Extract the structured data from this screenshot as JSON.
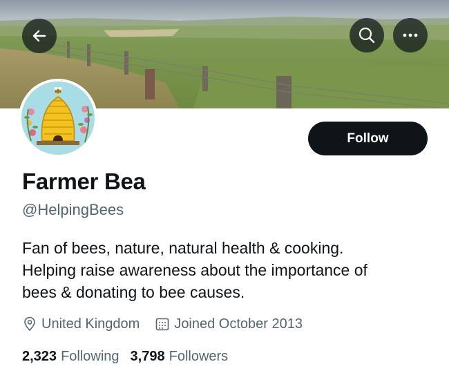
{
  "header": {
    "back_icon": "arrow-left-icon",
    "search_icon": "search-icon",
    "more_icon": "more-horizontal-icon"
  },
  "profile": {
    "display_name": "Farmer Bea",
    "handle": "@HelpingBees",
    "follow_label": "Follow",
    "bio_lines": [
      "Fan of bees, nature, natural health & cooking.",
      "Helping raise awareness about the importance of",
      "bees & donating to bee causes."
    ],
    "location": "United Kingdom",
    "location_icon": "location-pin-icon",
    "joined": "Joined October 2013",
    "joined_icon": "calendar-icon",
    "following_count": "2,323",
    "following_label": "Following",
    "followers_count": "3,798",
    "followers_label": "Followers"
  },
  "colors": {
    "text_primary": "#0f1419",
    "text_secondary": "#536471",
    "button_bg": "#0f1419",
    "avatar_bg": "#a8dde6"
  }
}
